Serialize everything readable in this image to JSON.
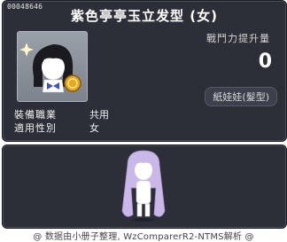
{
  "item": {
    "id": "00048646",
    "title": "紫色亭亭玉立发型 (女)",
    "stat_label": "戰鬥力提升量",
    "stat_value": "0",
    "category": "紙娃娃(髮型)",
    "job_label": "裝備職業",
    "job_value": "共用",
    "gender_label": "適用性別",
    "gender_value": "女"
  },
  "footer": {
    "text": "@ 数据由小册子整理, WzComparerR2-NTMS解析 @"
  },
  "icons": {
    "item_icon": "hairstyle-icon",
    "coin_icon": "gold-coin-icon",
    "preview": "character-preview"
  },
  "colors": {
    "panel_bg": "#2c2f38",
    "title": "#ffffff",
    "hair_preview": "#c9b8e8"
  }
}
